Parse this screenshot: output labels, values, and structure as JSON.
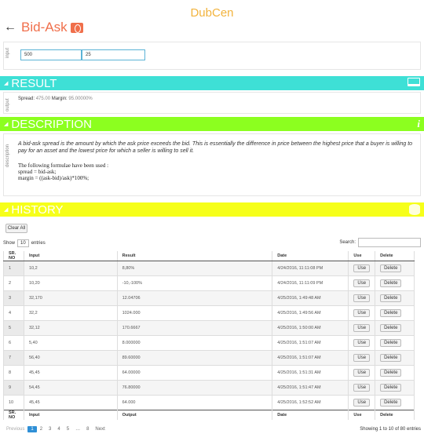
{
  "app": {
    "title": "DubCen"
  },
  "page": {
    "back_glyph": "←",
    "title": "Bid-Ask",
    "title_icon": "calculator-icon"
  },
  "input_section": {
    "label": "input",
    "field1": "500",
    "field2": "25"
  },
  "result_section": {
    "header": "RESULT",
    "label": "output",
    "spread_label": "Spread:",
    "spread_value": "475.00",
    "margin_label": "Margin:",
    "margin_value": "95.00000%"
  },
  "description_section": {
    "header": "DESCRIPTION",
    "label": "description",
    "text": "A bid-ask spread is the amount by which the ask price exceeds the bid. This is essentially the difference in price between the highest price that a buyer is willing to pay for an asset and the lowest price for which a seller is willing to sell it.",
    "formulae_intro": "The following formulae have been used :",
    "formula1": "spread = bid-ask;",
    "formula2": "margin = ((ask-bid)/ask)*100%;"
  },
  "history_section": {
    "header": "HISTORY",
    "clear_all": "Clear All",
    "show_label": "Show",
    "show_count": "10",
    "entries_label": "entries",
    "search_label": "Search:",
    "search_value": "",
    "columns": [
      "SR. NO",
      "Input",
      "Result",
      "Date",
      "Use",
      "Delete"
    ],
    "footer_columns": [
      "SR. NO",
      "Input",
      "Output",
      "Date",
      "Use",
      "Delete"
    ],
    "use_label": "Use",
    "delete_label": "Delete",
    "rows": [
      {
        "sr": "1",
        "input": "10,2",
        "result": "8,80%",
        "date": "4/24/2016, 11:11:08 PM"
      },
      {
        "sr": "2",
        "input": "10,20",
        "result": "-10,-100%",
        "date": "4/24/2016, 11:11:09 PM"
      },
      {
        "sr": "3",
        "input": "32,170",
        "result": "12.04706",
        "date": "4/25/2016, 1:49:48 AM"
      },
      {
        "sr": "4",
        "input": "32,2",
        "result": "1024.000",
        "date": "4/25/2016, 1:49:56 AM"
      },
      {
        "sr": "5",
        "input": "32,12",
        "result": "170.6667",
        "date": "4/25/2016, 1:50:00 AM"
      },
      {
        "sr": "6",
        "input": "5,40",
        "result": "8.000000",
        "date": "4/25/2016, 1:51:07 AM"
      },
      {
        "sr": "7",
        "input": "56,40",
        "result": "89.60000",
        "date": "4/25/2016, 1:51:07 AM"
      },
      {
        "sr": "8",
        "input": "45,45",
        "result": "64.00000",
        "date": "4/25/2016, 1:51:31 AM"
      },
      {
        "sr": "9",
        "input": "54,45",
        "result": "76.80000",
        "date": "4/25/2016, 1:51:47 AM"
      },
      {
        "sr": "10",
        "input": "45,45",
        "result": "64.000",
        "date": "4/25/2016, 1:52:52 AM"
      }
    ],
    "pagination": {
      "previous": "Previous",
      "pages": [
        "1",
        "2",
        "3",
        "4",
        "5",
        "…",
        "8"
      ],
      "next": "Next",
      "current": "1"
    },
    "showing": "Showing 1 to 10 of 80 entries"
  }
}
